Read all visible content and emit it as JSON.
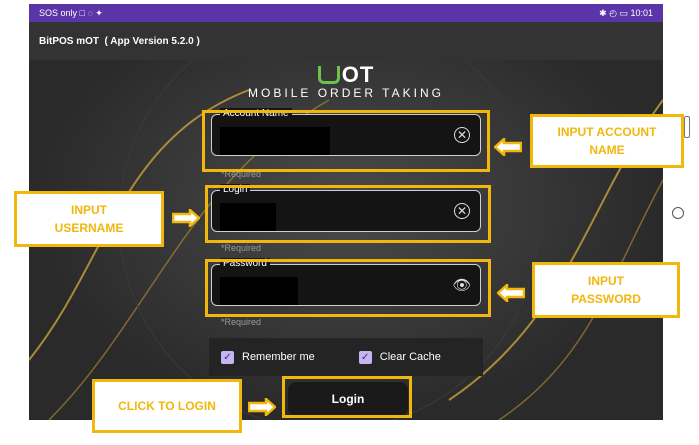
{
  "status_bar": {
    "left_text": "SOS only □ ◌ ✦",
    "right_text": "✱ ◴ ▭ 10:01"
  },
  "app_bar": {
    "title": "BitPOS mOT  ( App Version 5.2.0 )"
  },
  "logo": {
    "mark_text": "OT",
    "subtitle": "MOBILE ORDER TAKING"
  },
  "form": {
    "account_name": {
      "label": "Account Name",
      "helper": "*Required",
      "icon": "clear-icon"
    },
    "login": {
      "label": "Login",
      "helper": "*Required",
      "icon": "clear-icon"
    },
    "password": {
      "label": "Password",
      "helper": "*Required",
      "icon": "eye-icon"
    },
    "remember_me": {
      "label": "Remember me",
      "checked": true
    },
    "clear_cache": {
      "label": "Clear Cache",
      "checked": true
    },
    "login_button": "Login"
  },
  "annotations": {
    "account_name": "INPUT ACCOUNT NAME",
    "username_line1": "INPUT",
    "username_line2": "USERNAME",
    "password_line1": "INPUT",
    "password_line2": "PASSWORD",
    "click_login": "CLICK TO LOGIN",
    "color": "#f2b70c"
  },
  "colors": {
    "status_bar": "#5b35a8",
    "app_bar": "#333333",
    "checkbox": "#c6b4f0"
  }
}
